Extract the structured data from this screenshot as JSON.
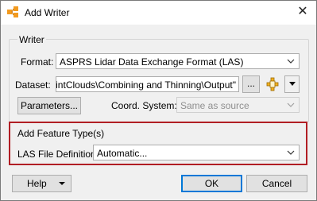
{
  "window": {
    "title": "Add Writer",
    "close_glyph": "✕"
  },
  "writer_group": {
    "title": "Writer",
    "format_label": "Format:",
    "format_value": "ASPRS Lidar Data Exchange Format (LAS)",
    "dataset_label": "Dataset:",
    "dataset_value": "S PointClouds\\Combining and Thinning\\Output\"",
    "browse_label": "...",
    "parameters_label": "Parameters...",
    "coord_label": "Coord. System:",
    "coord_value": "Same as source"
  },
  "feature_group": {
    "title": "Add Feature Type(s)",
    "las_def_label": "LAS File Definition:",
    "las_def_value": "Automatic..."
  },
  "buttons": {
    "help": "Help",
    "ok": "OK",
    "cancel": "Cancel"
  },
  "colors": {
    "highlight_border": "#b11e24",
    "default_button_border": "#0078d7"
  },
  "icons": [
    "app-icon",
    "close-icon",
    "chevron-down-icon",
    "folder-feature-icon"
  ]
}
